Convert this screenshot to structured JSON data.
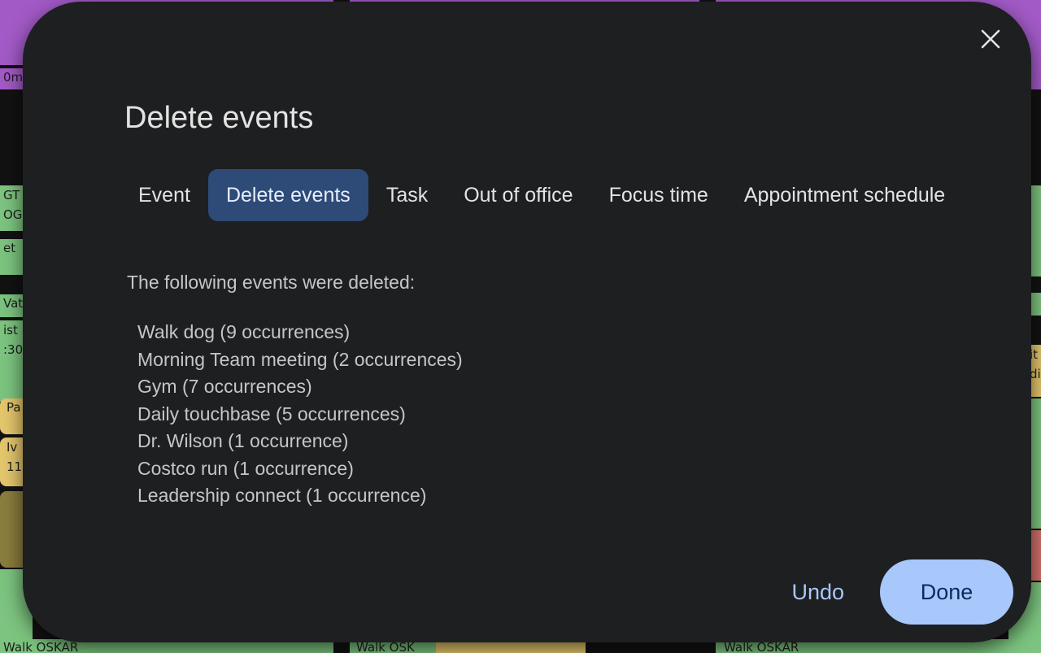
{
  "background": {
    "block_texts": {
      "left_1": "0m",
      "left_2": "GT",
      "left_3": "OG",
      "left_4": "et",
      "left_5": "Vat",
      "left_6": "ist",
      "left_7": ":30",
      "left_8": "Pa",
      "left_9": "Iv",
      "left_10": "11",
      "right_1": "it",
      "right_2": "di",
      "bottom_1": "Walk OSKAR",
      "bottom_2": "Walk OSK",
      "bottom_3": "Walk OSKAR"
    }
  },
  "dialog": {
    "title": "Delete events",
    "close_label": "×",
    "tabs": [
      {
        "label": "Event",
        "active": false
      },
      {
        "label": "Delete events",
        "active": true
      },
      {
        "label": "Task",
        "active": false
      },
      {
        "label": "Out of office",
        "active": false
      },
      {
        "label": "Focus time",
        "active": false
      },
      {
        "label": "Appointment schedule",
        "active": false
      }
    ],
    "message": "The following events were deleted:",
    "deleted_events": [
      "Walk dog (9 occurrences)",
      "Morning Team meeting (2 occurrences)",
      "Gym (7 occurrences)",
      "Daily touchbase (5 occurrences)",
      "Dr. Wilson (1 occurrence)",
      "Costco run (1 occurrence)",
      "Leadership connect (1 occurrence)"
    ],
    "undo_label": "Undo",
    "done_label": "Done"
  },
  "colors": {
    "dialog_bg": "#1e1f21",
    "active_tab_bg": "#2e4b78",
    "accent": "#a8c7fa",
    "done_text": "#0b2a5e"
  }
}
